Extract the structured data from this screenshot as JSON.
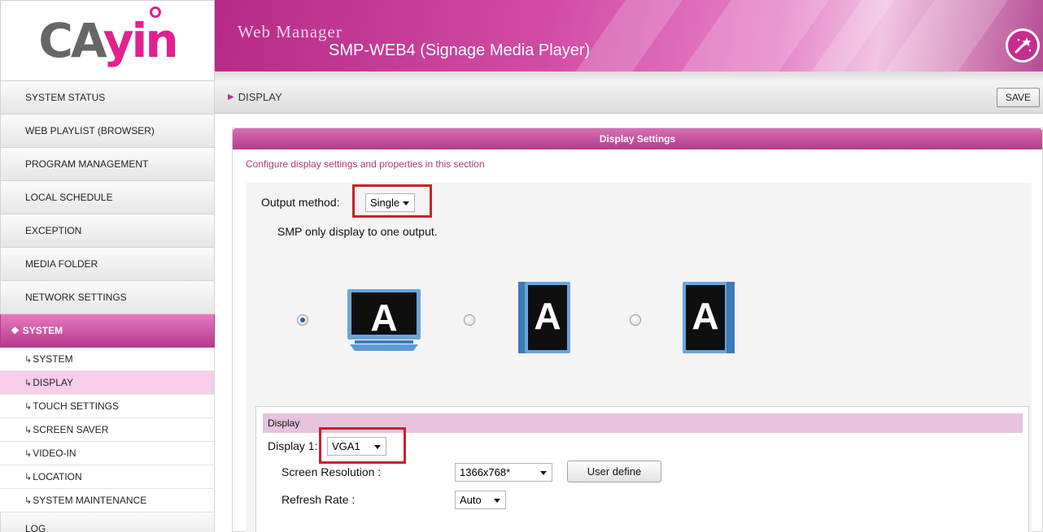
{
  "brand": {
    "logo_text_main": "CA",
    "logo_text_accent": "yin",
    "accent_color": "#c2378f"
  },
  "header": {
    "app_title": "Web Manager",
    "device_title": "SMP-WEB4 (Signage Media Player)",
    "wand_icon": "wand-icon"
  },
  "nav": {
    "items": [
      {
        "label": "SYSTEM STATUS"
      },
      {
        "label": "WEB PLAYLIST (BROWSER)"
      },
      {
        "label": "PROGRAM MANAGEMENT"
      },
      {
        "label": "LOCAL SCHEDULE"
      },
      {
        "label": "EXCEPTION"
      },
      {
        "label": "MEDIA FOLDER"
      },
      {
        "label": "NETWORK SETTINGS"
      }
    ],
    "active": {
      "icon": "❖",
      "label": "SYSTEM"
    },
    "sub_items": [
      {
        "label": "SYSTEM"
      },
      {
        "label": "DISPLAY"
      },
      {
        "label": "TOUCH SETTINGS"
      },
      {
        "label": "SCREEN SAVER"
      },
      {
        "label": "VIDEO-IN"
      },
      {
        "label": "LOCATION"
      },
      {
        "label": "SYSTEM MAINTENANCE"
      }
    ],
    "sub_arrow": "↳",
    "next_item": {
      "label": "LOG"
    }
  },
  "breadcrumb": {
    "arrow": "▶",
    "label": "DISPLAY"
  },
  "toolbar": {
    "save_label": "SAVE"
  },
  "panel": {
    "title": "Display Settings",
    "description": "Configure display settings and properties in this section",
    "output_method_label": "Output method:",
    "output_method_value": "Single",
    "output_description": "SMP only display to one output.",
    "layout_options": [
      {
        "icon": "monitor-landscape-icon",
        "glyph": "A",
        "checked": true
      },
      {
        "icon": "monitor-portrait-left-icon",
        "glyph": "A",
        "checked": false
      },
      {
        "icon": "monitor-portrait-right-icon",
        "glyph": "A",
        "checked": false
      }
    ],
    "display_section": {
      "header": "Display",
      "display1_label": "Display 1:",
      "display1_value": "VGA1",
      "resolution_label": "Screen Resolution :",
      "resolution_value": "1366x768*",
      "user_define_label": "User define",
      "refresh_label": "Refresh Rate :",
      "refresh_value": "Auto"
    }
  }
}
